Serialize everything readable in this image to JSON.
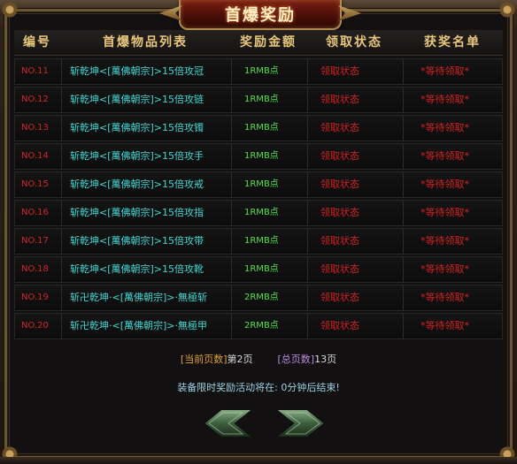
{
  "title": "首爆奖励",
  "header": {
    "num": "编号",
    "item": "首爆物品列表",
    "amount": "奖励金额",
    "status": "领取状态",
    "winner": "获奖名单"
  },
  "rows": [
    {
      "num": "NO.11",
      "item": "斩乾坤<[萬佛朝宗]>15倍攻冠",
      "amount": "1RMB点",
      "status": "领取状态",
      "winner": "*等待领取*"
    },
    {
      "num": "NO.12",
      "item": "斩乾坤<[萬佛朝宗]>15倍攻链",
      "amount": "1RMB点",
      "status": "领取状态",
      "winner": "*等待领取*"
    },
    {
      "num": "NO.13",
      "item": "斩乾坤<[萬佛朝宗]>15倍攻镯",
      "amount": "1RMB点",
      "status": "领取状态",
      "winner": "*等待领取*"
    },
    {
      "num": "NO.14",
      "item": "斩乾坤<[萬佛朝宗]>15倍攻手",
      "amount": "1RMB点",
      "status": "领取状态",
      "winner": "*等待领取*"
    },
    {
      "num": "NO.15",
      "item": "斩乾坤<[萬佛朝宗]>15倍攻戒",
      "amount": "1RMB点",
      "status": "领取状态",
      "winner": "*等待领取*"
    },
    {
      "num": "NO.16",
      "item": "斩乾坤<[萬佛朝宗]>15倍攻指",
      "amount": "1RMB点",
      "status": "领取状态",
      "winner": "*等待领取*"
    },
    {
      "num": "NO.17",
      "item": "斩乾坤<[萬佛朝宗]>15倍攻带",
      "amount": "1RMB点",
      "status": "领取状态",
      "winner": "*等待领取*"
    },
    {
      "num": "NO.18",
      "item": "斩乾坤<[萬佛朝宗]>15倍攻靴",
      "amount": "1RMB点",
      "status": "领取状态",
      "winner": "*等待领取*"
    },
    {
      "num": "NO.19",
      "item": "斩卍乾坤·<[萬佛朝宗]>·無極斩",
      "amount": "2RMB点",
      "status": "领取状态",
      "winner": "*等待领取*"
    },
    {
      "num": "NO.20",
      "item": "斩卍乾坤·<[萬佛朝宗]>·無極甲",
      "amount": "2RMB点",
      "status": "领取状态",
      "winner": "*等待领取*"
    }
  ],
  "pagination": {
    "current_label": "[当前页数]",
    "current_value": "第2页",
    "total_label": "[总页数]",
    "total_value": "13页"
  },
  "notice": "装备限时奖励活动将在: 0分钟后结束!",
  "icons": {
    "prev": "chevron-left-icon",
    "next": "chevron-right-icon"
  },
  "colors": {
    "number": "#d02525",
    "item": "#3fd9d4",
    "amount": "#4fe24a",
    "status": "#d42222",
    "header": "#e8c77a"
  }
}
